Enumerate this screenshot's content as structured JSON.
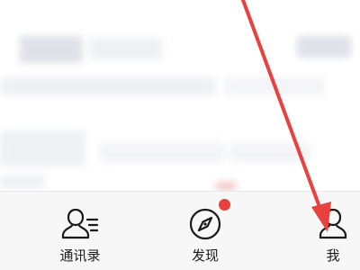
{
  "tabbar": {
    "tabs": [
      {
        "id": "contacts",
        "label": "通讯录",
        "icon": "contacts-icon"
      },
      {
        "id": "discover",
        "label": "发现",
        "icon": "compass-icon",
        "badge": true
      },
      {
        "id": "me",
        "label": "我",
        "icon": "person-icon"
      }
    ]
  },
  "colors": {
    "badge": "#e8413e",
    "annotation_arrow": "#e8413e",
    "tab_bar_bg": "#f7f7f7",
    "text": "#1a1a1a"
  }
}
